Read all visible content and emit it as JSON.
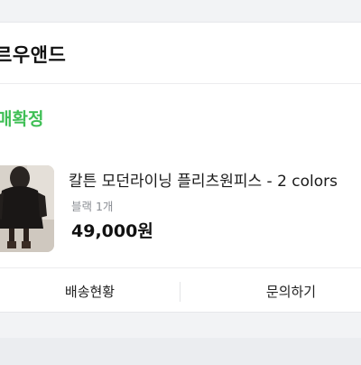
{
  "store": {
    "name": "르우앤드"
  },
  "order": {
    "status": "매확정",
    "item": {
      "title": "칼튼 모던라이닝 플리츠원피스 - 2 colors",
      "option": "블랙 1개",
      "price": "49,000원",
      "thumbnail_icon": "dress-photo-thumbnail"
    },
    "actions": {
      "shipping_label": "배송현황",
      "inquiry_label": "문의하기"
    }
  },
  "colors": {
    "status_green": "#3fbf55",
    "page_bg": "#f2f3f5",
    "card_bg": "#ffffff"
  }
}
